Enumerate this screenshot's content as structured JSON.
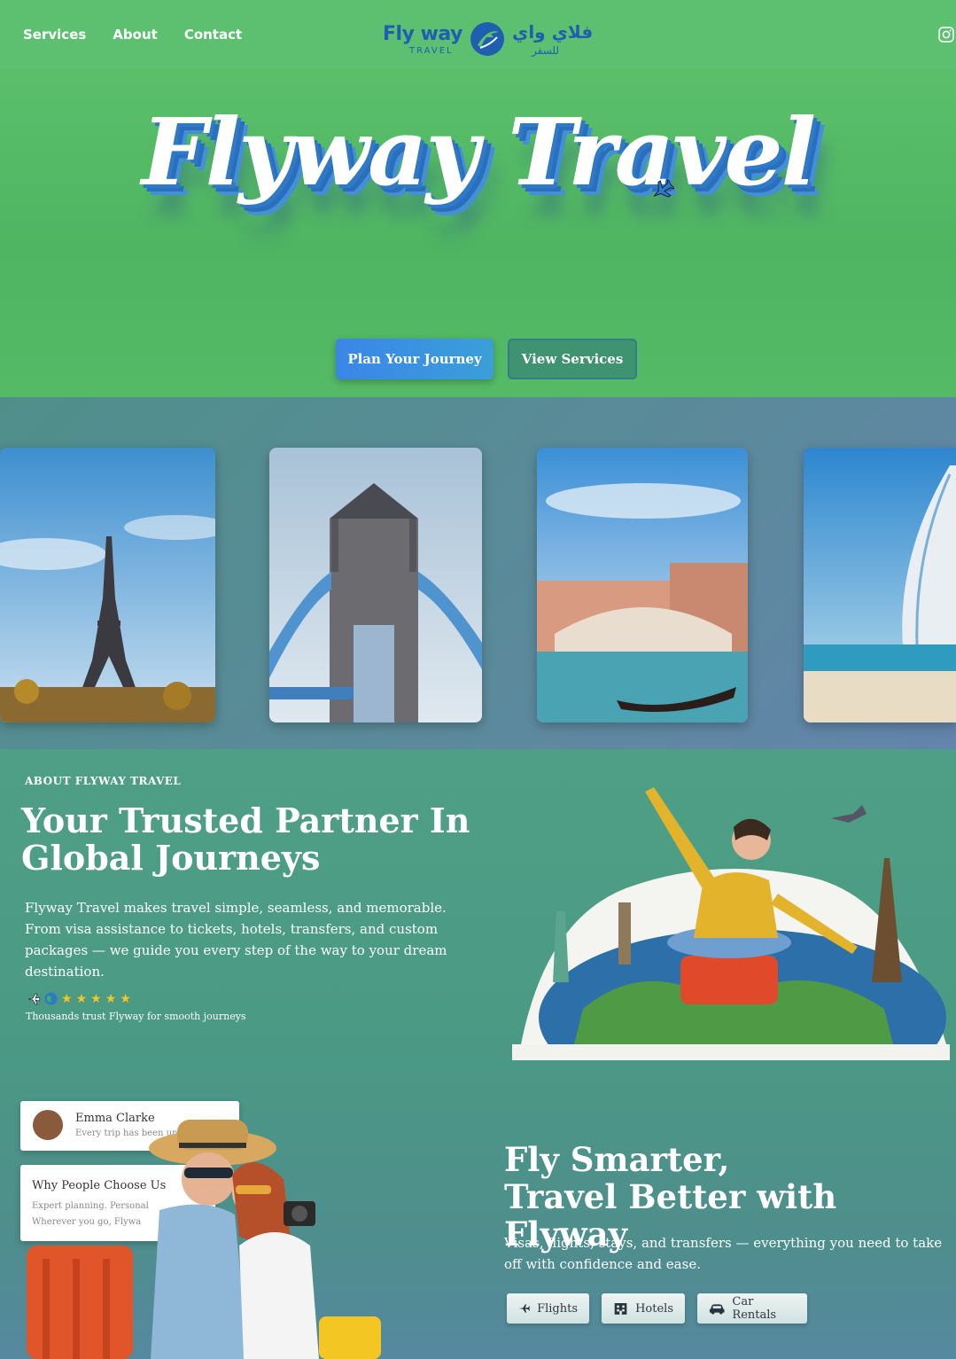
{
  "nav": {
    "links": [
      "Services",
      "About",
      "Contact"
    ],
    "logo_en": "Fly way",
    "logo_en_sub": "TRAVEL",
    "logo_ar": "فلاي واي",
    "logo_ar_sub": "للسفر"
  },
  "hero": {
    "title": "Flyway Travel",
    "primary_button": "Plan Your Journey",
    "secondary_button": "View Services"
  },
  "about": {
    "kicker": "ABOUT FLYWAY TRAVEL",
    "heading": "Your Trusted Partner In Global Journeys",
    "paragraph": "Flyway Travel makes travel simple, seamless, and memorable. From visa assistance to tickets, hotels, transfers, and custom packages — we guide you every step of the way to your dream destination.",
    "rating_icons": [
      "plane-icon",
      "globe-icon",
      "star",
      "star",
      "star",
      "star",
      "star"
    ],
    "trust_line": "Thousands trust Flyway for smooth journeys"
  },
  "testimonial": {
    "name": "Emma Clarke",
    "text": "Every trip has been unf"
  },
  "why_card": {
    "heading": "Why People Choose Us",
    "line1": "Expert planning. Personal",
    "line2": "Wherever you go, Flywa"
  },
  "feature": {
    "heading_line1": "Fly Smarter,",
    "heading_line2": "Travel Better with Flyway",
    "paragraph": "Visas, flights, stays, and transfers — everything you need to take off with confidence and ease.",
    "chips": [
      {
        "label": "Flights",
        "icon": "plane-icon"
      },
      {
        "label": "Hotels",
        "icon": "hotel-icon"
      },
      {
        "label": "Car Rentals",
        "icon": "car-icon"
      }
    ]
  },
  "colors": {
    "nav_bg": "#5cc070",
    "hero_bg": "#4fb562",
    "brand_blue": "#1f5fb0",
    "primary_button": "#3a86e8",
    "secondary_button": "#3f9370"
  }
}
